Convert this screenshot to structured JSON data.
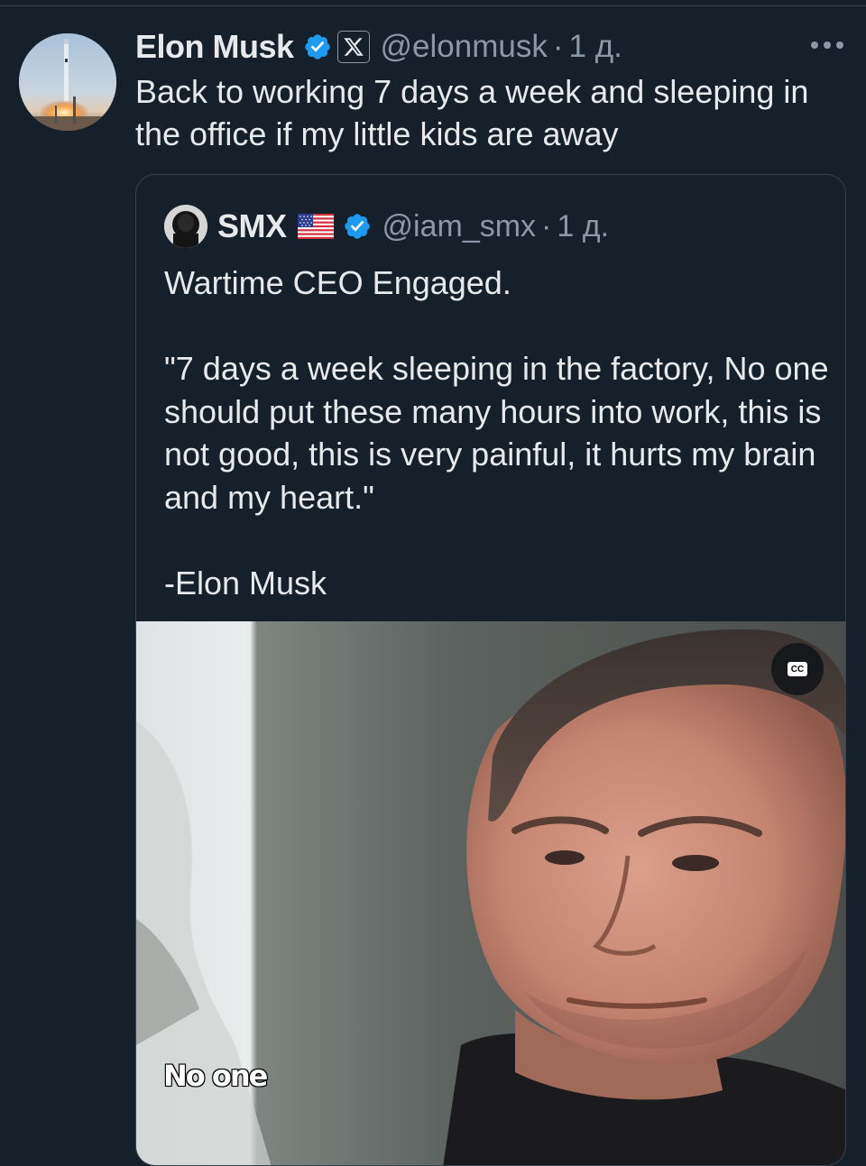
{
  "tweet": {
    "display_name": "Elon Musk",
    "handle": "@elonmusk",
    "separator": "·",
    "time": "1 д.",
    "text": "Back to working 7 days a week and sleeping in the office if my little kids are away",
    "avatar_icon": "rocket-launch-avatar",
    "verified_icon": "verified-badge-icon",
    "affiliate_icon": "x-logo-icon",
    "more_icon": "more-options-icon"
  },
  "quote": {
    "display_name": "SMX",
    "flag_icon": "us-flag-icon",
    "verified_icon": "verified-badge-icon",
    "handle": "@iam_smx",
    "separator": "·",
    "time": "1 д.",
    "text_line_1": "Wartime CEO Engaged.",
    "text_line_2": "\"7 days a week sleeping in the factory, No one should put these many hours into work, this is not good, this is very painful, it hurts my brain and my heart.\"",
    "text_line_3": "-Elon Musk",
    "video": {
      "cc_label": "CC",
      "subtitle": "No one"
    }
  },
  "colors": {
    "background": "#15202b",
    "text_primary": "#e7e9ea",
    "text_secondary": "#8b98a5",
    "border": "#38444d",
    "verified_blue": "#1d9bf0"
  }
}
